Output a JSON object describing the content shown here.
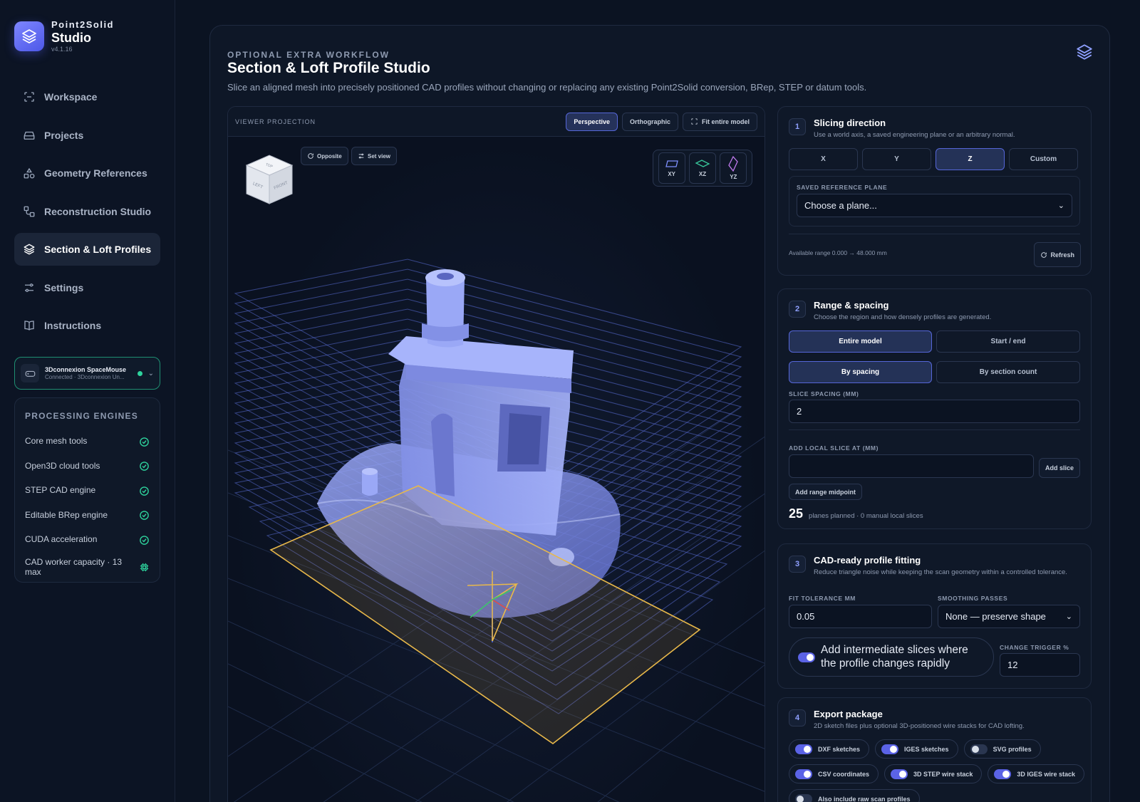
{
  "brand": {
    "line1": "Point2Solid",
    "line2": "Studio",
    "version": "v4.1.16"
  },
  "nav": [
    {
      "label": "Workspace",
      "icon": "scan-icon"
    },
    {
      "label": "Projects",
      "icon": "drive-icon"
    },
    {
      "label": "Geometry References",
      "icon": "shapes-icon"
    },
    {
      "label": "Reconstruction Studio",
      "icon": "workflow-icon"
    },
    {
      "label": "Section & Loft Profiles",
      "icon": "layers-icon",
      "active": true
    },
    {
      "label": "Settings",
      "icon": "sliders-icon"
    },
    {
      "label": "Instructions",
      "icon": "book-icon"
    }
  ],
  "device": {
    "name": "3Dconnexion SpaceMouse",
    "status": "Connected · 3Dconnexion Un..."
  },
  "engines": {
    "title": "PROCESSING ENGINES",
    "items": [
      "Core mesh tools",
      "Open3D cloud tools",
      "STEP CAD engine",
      "Editable BRep engine",
      "CUDA acceleration",
      "CAD worker capacity · 13 max"
    ]
  },
  "header": {
    "kicker": "OPTIONAL EXTRA WORKFLOW",
    "title": "Section & Loft Profile Studio",
    "subtitle": "Slice an aligned mesh into precisely positioned CAD profiles without changing or replacing any existing Point2Solid conversion, BRep, STEP or datum tools."
  },
  "viewer": {
    "projection_label": "VIEWER PROJECTION",
    "perspective": "Perspective",
    "orthographic": "Orthographic",
    "fit": "Fit entire model",
    "opposite": "Opposite",
    "set_view": "Set view",
    "planes": [
      "XY",
      "XZ",
      "YZ"
    ],
    "cube": {
      "top": "TOP",
      "left": "LEFT",
      "front": "FRONT"
    }
  },
  "slicing": {
    "num": "1",
    "title": "Slicing direction",
    "subtitle": "Use a world axis, a saved engineering plane or an arbitrary normal.",
    "axes": [
      "X",
      "Y",
      "Z",
      "Custom"
    ],
    "selected_axis": "Z",
    "ref_label": "SAVED REFERENCE PLANE",
    "ref_value": "Choose a plane...",
    "range_text": "Available range 0.000 → 48.000 mm",
    "refresh": "Refresh"
  },
  "range": {
    "num": "2",
    "title": "Range & spacing",
    "subtitle": "Choose the region and how densely profiles are generated.",
    "region": [
      "Entire model",
      "Start / end"
    ],
    "mode": [
      "By spacing",
      "By section count"
    ],
    "spacing_label": "SLICE SPACING (MM)",
    "spacing_value": "2",
    "local_label": "ADD LOCAL SLICE AT (MM)",
    "local_value": "",
    "add_slice": "Add slice",
    "add_mid": "Add range midpoint",
    "planned_count": "25",
    "planned_text": "planes planned · 0 manual local slices"
  },
  "fitting": {
    "num": "3",
    "title": "CAD-ready profile fitting",
    "subtitle": "Reduce triangle noise while keeping the scan geometry within a controlled tolerance.",
    "tol_label": "FIT TOLERANCE MM",
    "tol_value": "0.05",
    "smooth_label": "SMOOTHING PASSES",
    "smooth_value": "None — preserve shape",
    "adaptive_label": "Add intermediate slices where the profile changes rapidly",
    "trigger_label": "CHANGE TRIGGER %",
    "trigger_value": "12"
  },
  "export": {
    "num": "4",
    "title": "Export package",
    "subtitle": "2D sketch files plus optional 3D-positioned wire stacks for CAD lofting.",
    "options": [
      {
        "label": "DXF sketches",
        "on": true
      },
      {
        "label": "IGES sketches",
        "on": true
      },
      {
        "label": "SVG profiles",
        "on": false
      },
      {
        "label": "CSV coordinates",
        "on": true
      },
      {
        "label": "3D STEP wire stack",
        "on": true
      },
      {
        "label": "3D IGES wire stack",
        "on": true
      },
      {
        "label": "Also include raw scan profiles",
        "on": false
      }
    ]
  },
  "colors": {
    "accent": "#5b63e6",
    "success": "#2ed39d",
    "slice_plane": "#e8b84a",
    "model": "#8d9cf2"
  }
}
